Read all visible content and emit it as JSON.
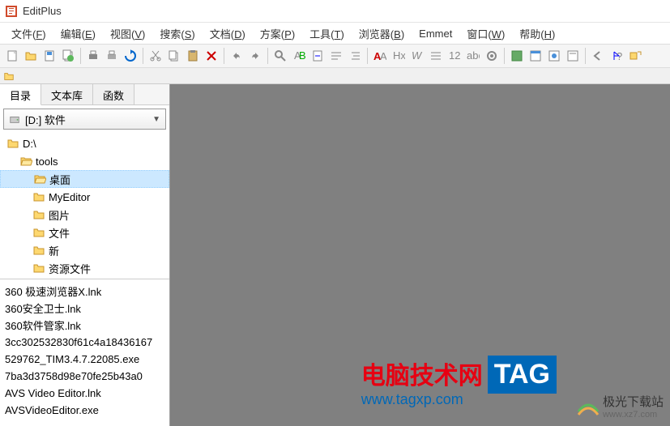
{
  "app": {
    "title": "EditPlus"
  },
  "menubar": {
    "items": [
      {
        "label": "文件(",
        "key": "F",
        "suffix": ")"
      },
      {
        "label": "编辑(",
        "key": "E",
        "suffix": ")"
      },
      {
        "label": "视图(",
        "key": "V",
        "suffix": ")"
      },
      {
        "label": "搜索(",
        "key": "S",
        "suffix": ")"
      },
      {
        "label": "文档(",
        "key": "D",
        "suffix": ")"
      },
      {
        "label": "方案(",
        "key": "P",
        "suffix": ")"
      },
      {
        "label": "工具(",
        "key": "T",
        "suffix": ")"
      },
      {
        "label": "浏览器(",
        "key": "B",
        "suffix": ")"
      },
      {
        "label": "Emmet",
        "key": "",
        "suffix": ""
      },
      {
        "label": "窗口(",
        "key": "W",
        "suffix": ")"
      },
      {
        "label": "帮助(",
        "key": "H",
        "suffix": ")"
      }
    ]
  },
  "sidebar": {
    "tabs": [
      {
        "label": "目录"
      },
      {
        "label": "文本库"
      },
      {
        "label": "函数"
      }
    ],
    "drive_select": "[D:] 软件",
    "tree": [
      {
        "label": "D:\\",
        "icon": "folder",
        "indent": 0,
        "selected": false
      },
      {
        "label": "tools",
        "icon": "folder-open",
        "indent": 1,
        "selected": false
      },
      {
        "label": "桌面",
        "icon": "folder-open",
        "indent": 2,
        "selected": true
      },
      {
        "label": "MyEditor",
        "icon": "folder",
        "indent": 2,
        "selected": false
      },
      {
        "label": "图片",
        "icon": "folder",
        "indent": 2,
        "selected": false
      },
      {
        "label": "文件",
        "icon": "folder",
        "indent": 2,
        "selected": false
      },
      {
        "label": "新",
        "icon": "folder",
        "indent": 2,
        "selected": false
      },
      {
        "label": "资源文件",
        "icon": "folder",
        "indent": 2,
        "selected": false
      }
    ],
    "files": [
      "360 极速浏览器X.lnk",
      "360安全卫士.lnk",
      "360软件管家.lnk",
      "3cc302532830f61c4a18436167",
      "529762_TIM3.4.7.22085.exe",
      "7ba3d3758d98e70fe25b43a0",
      "AVS Video Editor.lnk",
      "AVSVideoEditor.exe"
    ]
  },
  "watermark1": {
    "text1": "电脑技术网",
    "text2": "www.tagxp.com",
    "tag": "TAG"
  },
  "watermark2": {
    "text": "极光下载站",
    "url": "www.xz7.com"
  }
}
